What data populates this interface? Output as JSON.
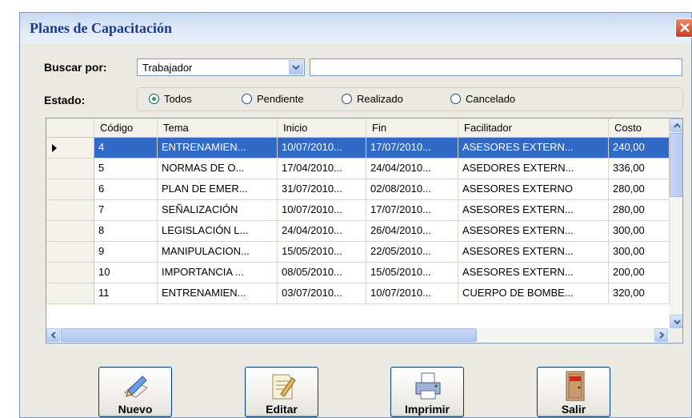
{
  "window": {
    "title": "Planes de Capacitación",
    "close_label": "✕"
  },
  "filters": {
    "buscar_label": "Buscar por:",
    "buscar_value": "Trabajador",
    "search_value": "",
    "estado_label": "Estado:",
    "estado_options": [
      "Todos",
      "Pendiente",
      "Realizado",
      "Cancelado"
    ],
    "estado_selected": "Todos"
  },
  "grid": {
    "columns": [
      "Código",
      "Tema",
      "Inicio",
      "Fin",
      "Facilitador",
      "Costo"
    ],
    "selected_row": 0,
    "rows": [
      [
        "4",
        "ENTRENAMIEN...",
        "10/07/2010...",
        "17/07/2010...",
        "ASESORES EXTERN...",
        "240,00"
      ],
      [
        "5",
        "NORMAS DE O...",
        "17/04/2010...",
        "24/04/2010...",
        "ASEDORES EXTERN...",
        "336,00"
      ],
      [
        "6",
        "PLAN DE EMER...",
        "31/07/2010...",
        "02/08/2010...",
        "ASESORES EXTERNO",
        "280,00"
      ],
      [
        "7",
        "SEÑALIZACIÓN",
        "10/07/2010...",
        "17/07/2010...",
        "ASESORES EXTERN...",
        "280,00"
      ],
      [
        "8",
        "LEGISLACIÓN L...",
        "24/04/2010...",
        "26/04/2010...",
        "ASESORES EXTERN...",
        "300,00"
      ],
      [
        "9",
        "MANIPULACION...",
        "15/05/2010...",
        "22/05/2010...",
        "ASESORES EXTERN...",
        "300,00"
      ],
      [
        "10",
        "IMPORTANCIA ...",
        "08/05/2010...",
        "15/05/2010...",
        "ASESORES EXTERN...",
        "200,00"
      ],
      [
        "11",
        "ENTRENAMIEN...",
        "03/07/2010...",
        "10/07/2010...",
        "CUERPO DE BOMBE...",
        "320,00"
      ]
    ]
  },
  "buttons": {
    "nuevo": {
      "label": "Nuevo",
      "icon": "pencil-paper-icon"
    },
    "editar": {
      "label": "Editar",
      "icon": "edit-document-icon"
    },
    "imprimir": {
      "label": "Imprimir",
      "icon": "printer-icon"
    },
    "salir": {
      "label": "Salir",
      "icon": "exit-door-icon"
    }
  },
  "colors": {
    "selection": "#3169c6",
    "title_text": "#1c3c8a",
    "window_bg": "#ebeae2"
  }
}
